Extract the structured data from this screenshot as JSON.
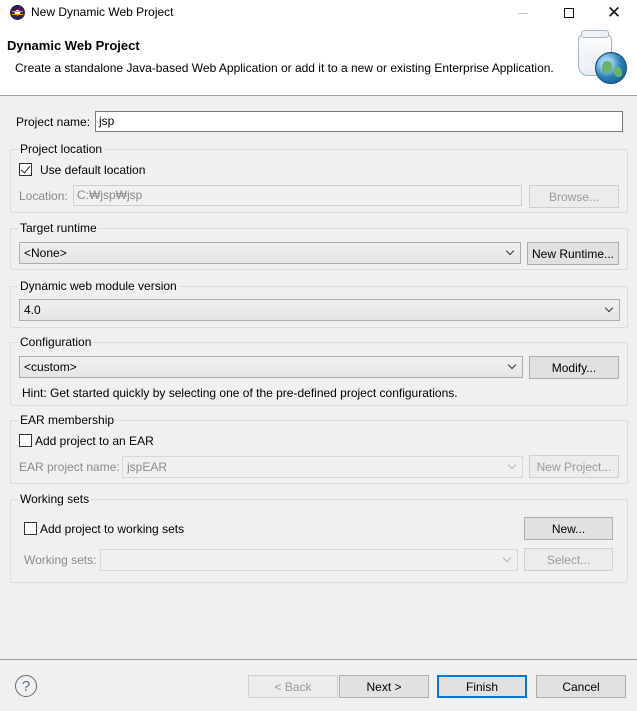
{
  "window": {
    "title": "New Dynamic Web Project"
  },
  "header": {
    "title": "Dynamic Web Project",
    "description": "Create a standalone Java-based Web Application or add it to a new or existing Enterprise Application."
  },
  "project_name": {
    "label": "Project name:",
    "value": "jsp"
  },
  "project_location": {
    "group_title": "Project location",
    "use_default_label": "Use default location",
    "use_default_checked": true,
    "location_label": "Location:",
    "location_value": "C:₩jsp₩jsp",
    "browse_label": "Browse..."
  },
  "target_runtime": {
    "group_title": "Target runtime",
    "selected": "<None>",
    "new_runtime_label": "New Runtime..."
  },
  "web_module": {
    "group_title": "Dynamic web module version",
    "selected": "4.0"
  },
  "configuration": {
    "group_title": "Configuration",
    "selected": "<custom>",
    "modify_label": "Modify...",
    "hint": "Hint: Get started quickly by selecting one of the pre-defined project configurations."
  },
  "ear": {
    "group_title": "EAR membership",
    "add_label": "Add project to an EAR",
    "add_checked": false,
    "project_name_label": "EAR project name:",
    "project_name_value": "jspEAR",
    "new_project_label": "New Project..."
  },
  "working_sets": {
    "group_title": "Working sets",
    "add_label": "Add project to working sets",
    "add_checked": false,
    "new_label": "New...",
    "sets_label": "Working sets:",
    "sets_value": "",
    "select_label": "Select..."
  },
  "footer": {
    "help_glyph": "?",
    "back_label": "< Back",
    "next_label": "Next >",
    "finish_label": "Finish",
    "cancel_label": "Cancel"
  }
}
